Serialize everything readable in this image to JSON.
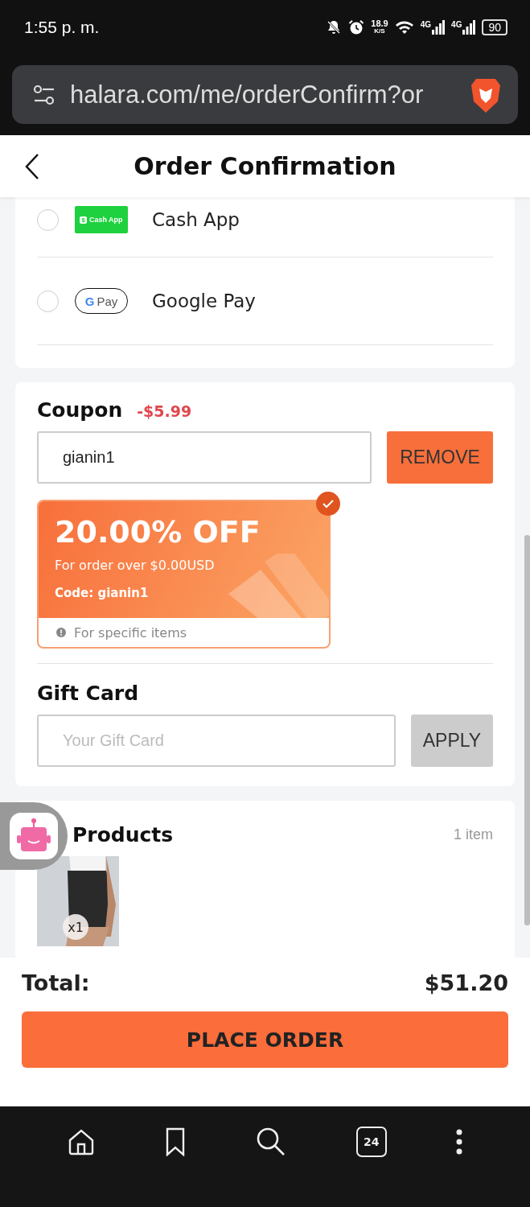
{
  "status_bar": {
    "time": "1:55 p. m.",
    "speed": "18.9",
    "speed_unit": "K/S",
    "network_1": "4G",
    "network_2": "4G",
    "battery": "90"
  },
  "browser": {
    "url": "halara.com/me/orderConfirm?or",
    "tab_count": "24"
  },
  "header": {
    "title": "Order Confirmation"
  },
  "payment_methods": [
    {
      "name": "Cash App",
      "kind": "cashapp",
      "logo_mark": "$",
      "logo_text": "Cash App",
      "selected": false
    },
    {
      "name": "Google Pay",
      "kind": "gpay",
      "logo_mark": "G",
      "logo_text": "Pay",
      "selected": false
    }
  ],
  "coupon": {
    "title": "Coupon",
    "discount": "-$5.99",
    "value": "gianin1",
    "button": "REMOVE",
    "card": {
      "headline": "20.00% OFF",
      "condition": "For order over $0.00USD",
      "code": "Code: gianin1",
      "note": "For specific items",
      "selected": true
    }
  },
  "gift_card": {
    "title": "Gift Card",
    "placeholder": "Your Gift Card",
    "button": "APPLY"
  },
  "products": {
    "title": "Products",
    "count": "1 item",
    "items": [
      {
        "kind": "picture",
        "quantity": "x1"
      }
    ]
  },
  "total": {
    "label": "Total:",
    "amount": "$51.20"
  },
  "place_order": "PLACE ORDER"
}
